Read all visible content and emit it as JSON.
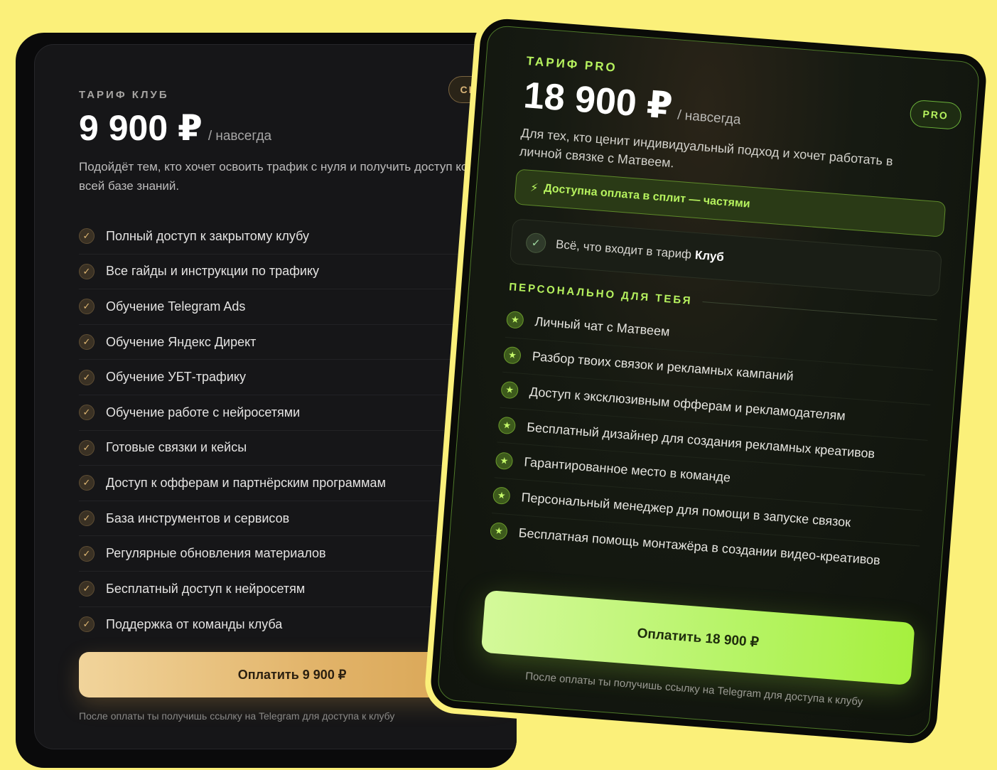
{
  "club": {
    "tag": "ТАРИФ КЛУБ",
    "badge": "CLUB",
    "price": "9 900 ₽",
    "price_suffix": "/ навсегда",
    "description": "Подойдёт тем, кто хочет освоить трафик с нуля и получить доступ ко всей базе знаний.",
    "features": [
      "Полный доступ к закрытому клубу",
      "Все гайды и инструкции по трафику",
      "Обучение Telegram Ads",
      "Обучение Яндекс Директ",
      "Обучение УБТ-трафику",
      "Обучение работе с нейросетями",
      "Готовые связки и кейсы",
      "Доступ к офферам и партнёрским программам",
      "База инструментов и сервисов",
      "Регулярные обновления материалов",
      "Бесплатный доступ к нейросетям",
      "Поддержка от команды клуба"
    ],
    "button": "Оплатить 9 900 ₽",
    "note": "После оплаты ты получишь ссылку на Telegram для доступа к клубу"
  },
  "pro": {
    "tag": "ТАРИФ PRO",
    "badge": "PRO",
    "price": "18 900 ₽",
    "price_suffix": "/ навсегда",
    "description": "Для тех, кто ценит индивидуальный подход и хочет работать в личной связке с Матвеем.",
    "split_text": "Доступна оплата в сплит — частями",
    "includes_prefix": "Всё, что входит в тариф",
    "includes_bold": "Клуб",
    "personal_title": "ПЕРСОНАЛЬНО ДЛЯ ТЕБЯ",
    "features": [
      "Личный чат с Матвеем",
      "Разбор твоих связок и рекламных кампаний",
      "Доступ к эксклюзивным офферам и рекламодателям",
      "Бесплатный дизайнер для создания рекламных креативов",
      "Гарантированное место в команде",
      "Персональный менеджер для помощи в запуске связок",
      "Бесплатная помощь монтажёра в создании видео-креативов"
    ],
    "button": "Оплатить 18 900 ₽",
    "note": "После оплаты ты получишь ссылку на Telegram для доступа к клубу"
  },
  "colors": {
    "background": "#fbf07a",
    "club_accent": "#e2b46a",
    "pro_accent": "#b6f25e"
  },
  "icons": {
    "club_check": "check-circle-icon",
    "pro_star": "star-circle-icon",
    "split": "lightning-icon"
  }
}
